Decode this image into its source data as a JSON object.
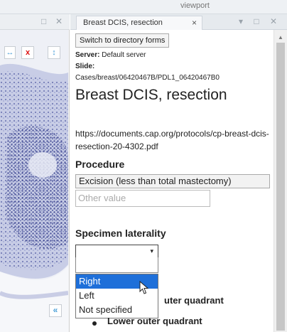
{
  "viewport": {
    "label": "viewport"
  },
  "left_panel": {
    "title_controls": [
      "□",
      "✕"
    ],
    "tool_x": "x",
    "tool_arrows": "↕",
    "tool_left": "↔",
    "collapse": "«",
    "bottom_buttons": [
      "✕",
      "↕"
    ]
  },
  "tab": {
    "title": "Breast DCIS, resection",
    "close": "×",
    "controls": "▾ □ ✕"
  },
  "form": {
    "switch_button": "Switch to directory forms",
    "server_label": "Server:",
    "server_value": "Default server",
    "slide_label": "Slide:",
    "slide_path": "Cases/breast/06420467B/PDL1_06420467B0",
    "title": "Breast DCIS, resection",
    "url": "https://documents.cap.org/protocols/cp-breast-dcis-resection-20-4302.pdf",
    "procedure_label": "Procedure",
    "procedure_value": "Excision (less than total mastectomy)",
    "other_placeholder": "Other value",
    "laterality_label": "Specimen laterality",
    "laterality_value": "",
    "laterality_arrow": "▾",
    "options": [
      "Right",
      "Left",
      "Not specified"
    ],
    "behind_item_1": "uter quadrant",
    "behind_item_2": "Lower outer quadrant"
  },
  "scrollbar": {
    "up": "▲"
  }
}
